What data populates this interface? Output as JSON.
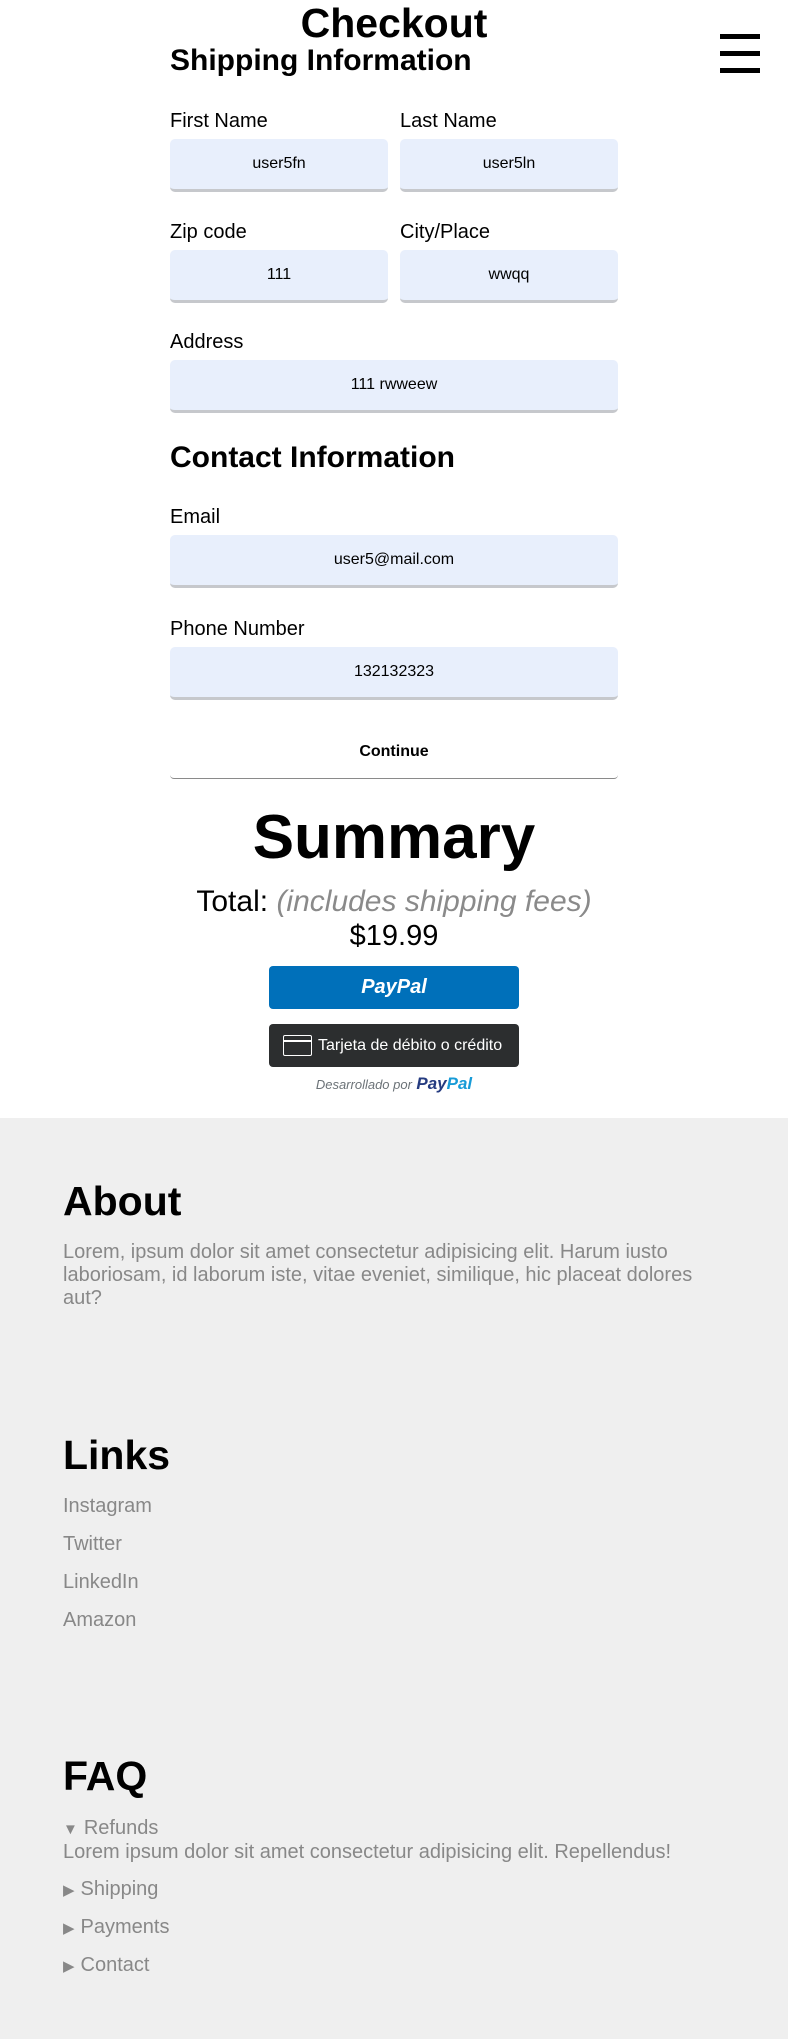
{
  "page": {
    "title": "Checkout"
  },
  "shipping": {
    "heading": "Shipping Information",
    "first_name": {
      "label": "First Name",
      "value": "user5fn"
    },
    "last_name": {
      "label": "Last Name",
      "value": "user5ln"
    },
    "zip": {
      "label": "Zip code",
      "value": "111"
    },
    "city": {
      "label": "City/Place",
      "value": "wwqq"
    },
    "address": {
      "label": "Address",
      "value": "111 rwweew"
    }
  },
  "contact": {
    "heading": "Contact Information",
    "email": {
      "label": "Email",
      "value": "user5@mail.com"
    },
    "phone": {
      "label": "Phone Number",
      "value": "132132323"
    }
  },
  "continue_label": "Continue",
  "summary": {
    "heading": "Summary",
    "total_label": "Total:",
    "total_note": "(includes shipping fees)",
    "price": "$19.99"
  },
  "payment": {
    "paypal_label": "PayPal",
    "card_label": "Tarjeta de débito o crédito",
    "card_icon": "credit-card-icon",
    "powered_by": "Desarrollado por",
    "logo_part1": "Pay",
    "logo_part2": "Pal"
  },
  "colors": {
    "input_bg": "#e8effc",
    "paypal_blue": "#0070ba",
    "card_dark": "#2c2e2f",
    "footer_bg": "#efefef",
    "muted_text": "#888888"
  },
  "footer": {
    "about": {
      "heading": "About",
      "text": "Lorem, ipsum dolor sit amet consectetur adipisicing elit. Harum iusto laboriosam, id laborum iste, vitae eveniet, similique, hic placeat dolores aut?"
    },
    "links": {
      "heading": "Links",
      "items": [
        "Instagram",
        "Twitter",
        "LinkedIn",
        "Amazon"
      ]
    },
    "faq": {
      "heading": "FAQ",
      "items": [
        {
          "label": "Refunds",
          "open": true,
          "body": "Lorem ipsum dolor sit amet consectetur adipisicing elit. Repellendus!"
        },
        {
          "label": "Shipping",
          "open": false
        },
        {
          "label": "Payments",
          "open": false
        },
        {
          "label": "Contact",
          "open": false
        }
      ]
    }
  }
}
